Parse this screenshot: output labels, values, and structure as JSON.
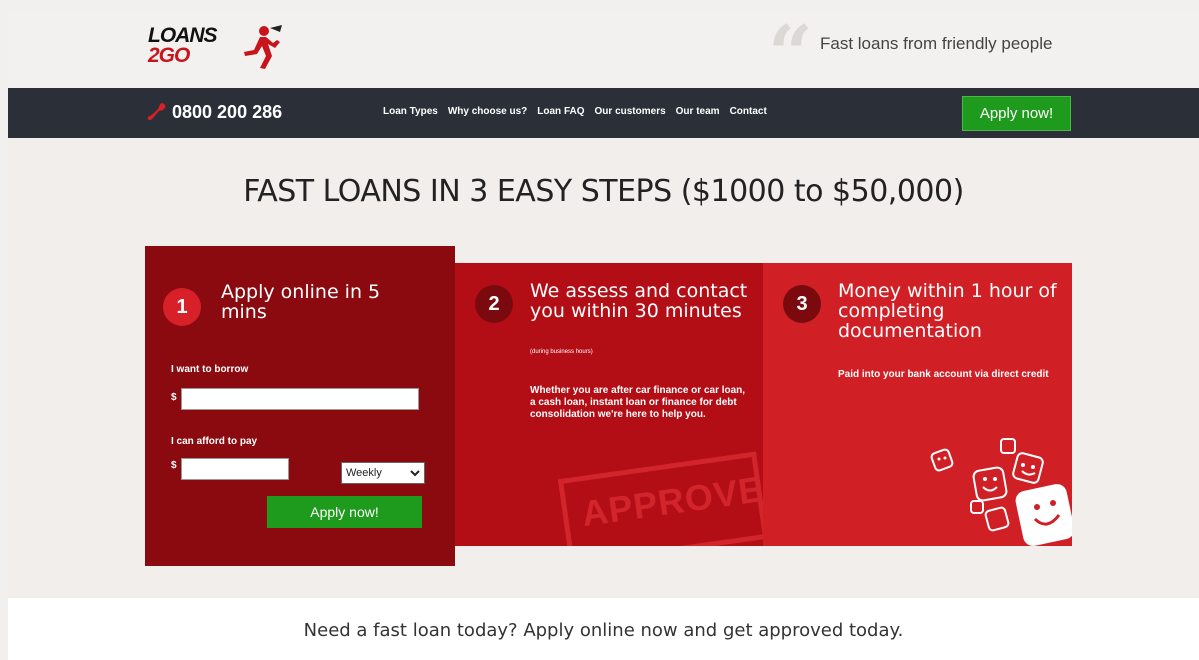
{
  "header": {
    "logo": {
      "line1": "LOANS",
      "line2": "2GO"
    },
    "tagline": "Fast loans from friendly people"
  },
  "nav": {
    "phone": "0800 200 286",
    "menu": [
      "Loan Types",
      "Why choose us?",
      "Loan FAQ",
      "Our customers",
      "Our team",
      "Contact"
    ],
    "apply_label": "Apply now!"
  },
  "main": {
    "title": "FAST LOANS IN 3 EASY STEPS ($1000 to $50,000)"
  },
  "steps": [
    {
      "number": "1",
      "title": "Apply online in 5 mins",
      "form": {
        "borrow_label": "I want to borrow",
        "afford_label": "I can afford to pay",
        "currency": "$",
        "borrow_value": "",
        "afford_value": "",
        "frequency": "Weekly",
        "apply_label": "Apply now!"
      }
    },
    {
      "number": "2",
      "title": "We assess and contact you within 30 minutes",
      "note": "(during business hours)",
      "description": "Whether you are after car finance or car loan, a cash loan, instant loan or finance for debt consolidation we're here to help you.",
      "stamp": "APPROVED"
    },
    {
      "number": "3",
      "title": "Money within 1 hour of completing documentation",
      "description": "Paid into your bank account via direct credit"
    }
  ],
  "footer": {
    "text": "Need a fast loan today? Apply online now and get approved today."
  },
  "colors": {
    "nav_bg": "#2b2f38",
    "green": "#1e9a1c",
    "step1": "#8a0a10",
    "step2": "#b30d16",
    "step3": "#d11f26"
  }
}
